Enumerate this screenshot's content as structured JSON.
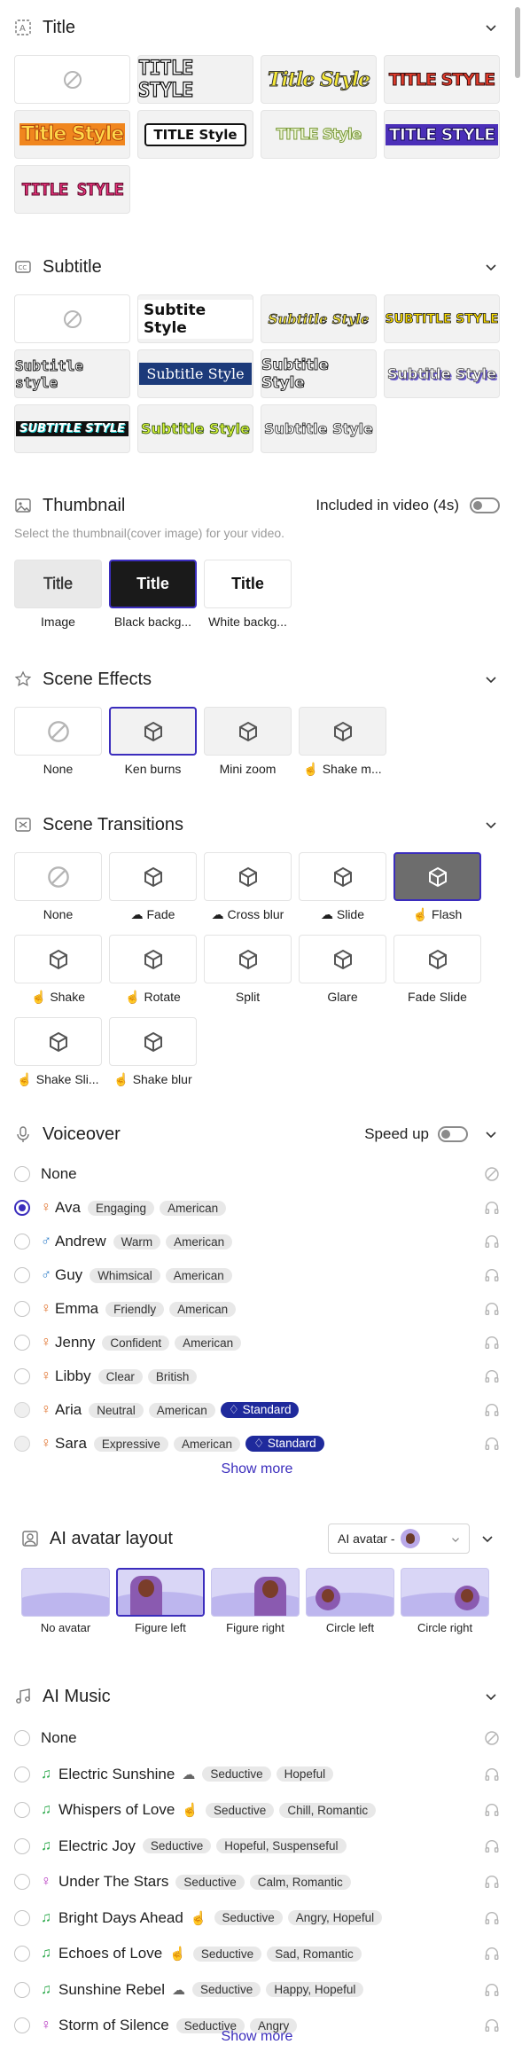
{
  "colors": {
    "accent": "#3b2dbd",
    "tag_standard": "#1f2a9c",
    "female": "#e0702a",
    "male": "#2d7dc8",
    "music_green": "#2ba84a",
    "music_purple": "#b535c0"
  },
  "title": {
    "heading": "Title",
    "icon": "title-icon",
    "styles": [
      "TITLE STYLE",
      "Title Style",
      "TITLE STYLE",
      "Title Style",
      "TITLE Style",
      "TITLE Style",
      "TITLE STYLE",
      "TITLE STYLE"
    ]
  },
  "subtitle": {
    "heading": "Subtitle",
    "icon": "cc-icon",
    "styles": [
      "Subtite Style",
      "Subtitle Style",
      "SUBTITLE STYLE",
      "Subtitle style",
      "Subtitle Style",
      "Subtitle Style",
      "Subtitle Style",
      "SUBTITLE STYLE",
      "Subtitle Style",
      "Subtitle Style"
    ]
  },
  "thumbnail": {
    "heading": "Thumbnail",
    "icon": "image-icon",
    "included_label": "Included in video (4s)",
    "description": "Select the thumbnail(cover image) for your video.",
    "items": [
      {
        "preview": "Title",
        "label": "Image"
      },
      {
        "preview": "Title",
        "label": "Black backg..."
      },
      {
        "preview": "Title",
        "label": "White backg..."
      }
    ]
  },
  "scene_effects": {
    "heading": "Scene Effects",
    "icon": "star-icon",
    "items": [
      "None",
      "Ken burns",
      "Mini zoom",
      "Shake m..."
    ]
  },
  "scene_transitions": {
    "heading": "Scene Transitions",
    "icon": "transition-icon",
    "items": [
      "None",
      "Fade",
      "Cross blur",
      "Slide",
      "Flash",
      "Shake",
      "Rotate",
      "Split",
      "Glare",
      "Fade Slide",
      "Shake Sli...",
      "Shake blur"
    ]
  },
  "voiceover": {
    "heading": "Voiceover",
    "icon": "mic-icon",
    "speed_label": "Speed up",
    "show_more": "Show more",
    "voices": [
      {
        "name": "None",
        "tags": []
      },
      {
        "name": "Ava",
        "gender": "♀",
        "tags": [
          "Engaging",
          "American"
        ]
      },
      {
        "name": "Andrew",
        "gender": "♂",
        "tags": [
          "Warm",
          "American"
        ]
      },
      {
        "name": "Guy",
        "gender": "♂",
        "tags": [
          "Whimsical",
          "American"
        ]
      },
      {
        "name": "Emma",
        "gender": "♀",
        "tags": [
          "Friendly",
          "American"
        ]
      },
      {
        "name": "Jenny",
        "gender": "♀",
        "tags": [
          "Confident",
          "American"
        ]
      },
      {
        "name": "Libby",
        "gender": "♀",
        "tags": [
          "Clear",
          "British"
        ]
      },
      {
        "name": "Aria",
        "gender": "♀",
        "tags": [
          "Neutral",
          "American"
        ],
        "badge": "Standard"
      },
      {
        "name": "Sara",
        "gender": "♀",
        "tags": [
          "Expressive",
          "American"
        ],
        "badge": "Standard"
      }
    ]
  },
  "avatar": {
    "heading": "AI avatar layout",
    "icon": "person-icon",
    "dropdown_label": "AI avatar -",
    "items": [
      "No avatar",
      "Figure left",
      "Figure right",
      "Circle left",
      "Circle right"
    ]
  },
  "music": {
    "heading": "AI Music",
    "icon": "music-icon",
    "show_more": "Show more",
    "tracks": [
      {
        "name": "None",
        "tags": []
      },
      {
        "name": "Electric Sunshine",
        "tags": [
          "Seductive",
          "Hopeful"
        ]
      },
      {
        "name": "Whispers of Love",
        "tags": [
          "Seductive",
          "Chill, Romantic"
        ]
      },
      {
        "name": "Electric Joy",
        "tags": [
          "Seductive",
          "Hopeful, Suspenseful"
        ]
      },
      {
        "name": "Under The Stars",
        "tags": [
          "Seductive",
          "Calm, Romantic"
        ]
      },
      {
        "name": "Bright Days Ahead",
        "tags": [
          "Seductive",
          "Angry, Hopeful"
        ]
      },
      {
        "name": "Echoes of Love",
        "tags": [
          "Seductive",
          "Sad, Romantic"
        ]
      },
      {
        "name": "Sunshine Rebel",
        "tags": [
          "Seductive",
          "Happy, Hopeful"
        ]
      },
      {
        "name": "Storm of Silence",
        "tags": [
          "Seductive",
          "Angry"
        ]
      }
    ]
  }
}
